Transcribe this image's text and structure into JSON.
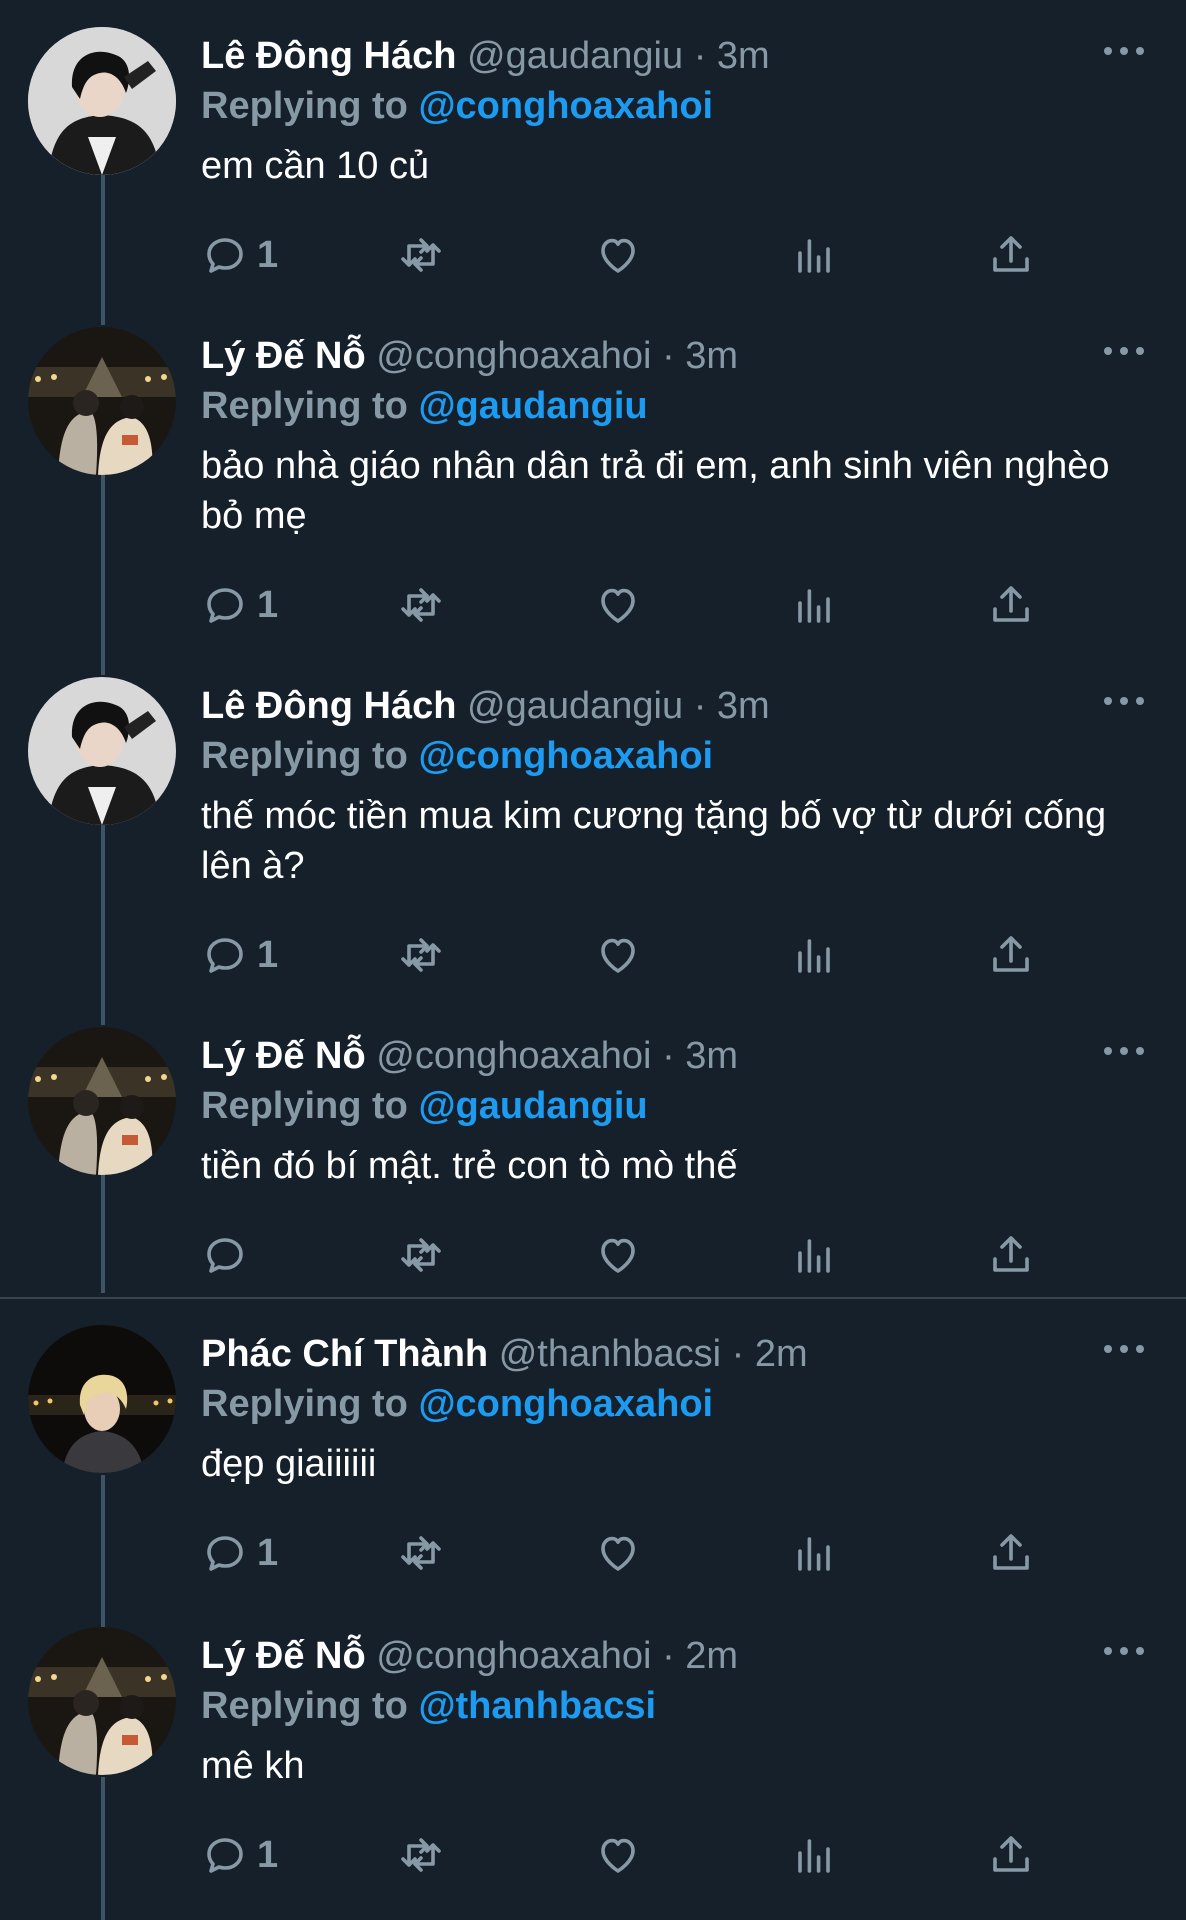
{
  "colors": {
    "background": "#15202b",
    "secondary_text": "#8899a6",
    "link": "#1d9bf0",
    "thread_line": "#3d5466",
    "divider": "#38444d"
  },
  "tweets": [
    {
      "name": "Lê Đông Hách",
      "handle": "@gaudangiu",
      "dot": "·",
      "time": "3m",
      "replying_prefix": "Replying to",
      "replying_to": "@conghoaxahoi",
      "text": "em cần 10 củ",
      "reply_count": "1",
      "avatar": "avatar-dark-hair-photo"
    },
    {
      "name": "Lý Đế Nỗ",
      "handle": "@conghoaxahoi",
      "dot": "·",
      "time": "3m",
      "replying_prefix": "Replying to",
      "replying_to": "@gaudangiu",
      "text": "bảo nhà giáo nhân dân trả đi em, anh sinh viên nghèo bỏ mẹ",
      "reply_count": "1",
      "avatar": "avatar-couple-night-photo"
    },
    {
      "name": "Lê Đông Hách",
      "handle": "@gaudangiu",
      "dot": "·",
      "time": "3m",
      "replying_prefix": "Replying to",
      "replying_to": "@conghoaxahoi",
      "text": "thế móc tiền mua kim cương tặng bố vợ từ dưới cống lên à?",
      "reply_count": "1",
      "avatar": "avatar-dark-hair-photo"
    },
    {
      "name": "Lý Đế Nỗ",
      "handle": "@conghoaxahoi",
      "dot": "·",
      "time": "3m",
      "replying_prefix": "Replying to",
      "replying_to": "@gaudangiu",
      "text": "tiền đó bí mật. trẻ con tò mò thế",
      "reply_count": "",
      "avatar": "avatar-couple-night-photo"
    },
    {
      "name": "Phác Chí Thành",
      "handle": "@thanhbacsi",
      "dot": "·",
      "time": "2m",
      "replying_prefix": "Replying to",
      "replying_to": "@conghoaxahoi",
      "text": "đẹp giaiiiiii",
      "reply_count": "1",
      "avatar": "avatar-blond-night-photo"
    },
    {
      "name": "Lý Đế Nỗ",
      "handle": "@conghoaxahoi",
      "dot": "·",
      "time": "2m",
      "replying_prefix": "Replying to",
      "replying_to": "@thanhbacsi",
      "text": "mê kh",
      "reply_count": "1",
      "avatar": "avatar-couple-night-photo"
    }
  ]
}
